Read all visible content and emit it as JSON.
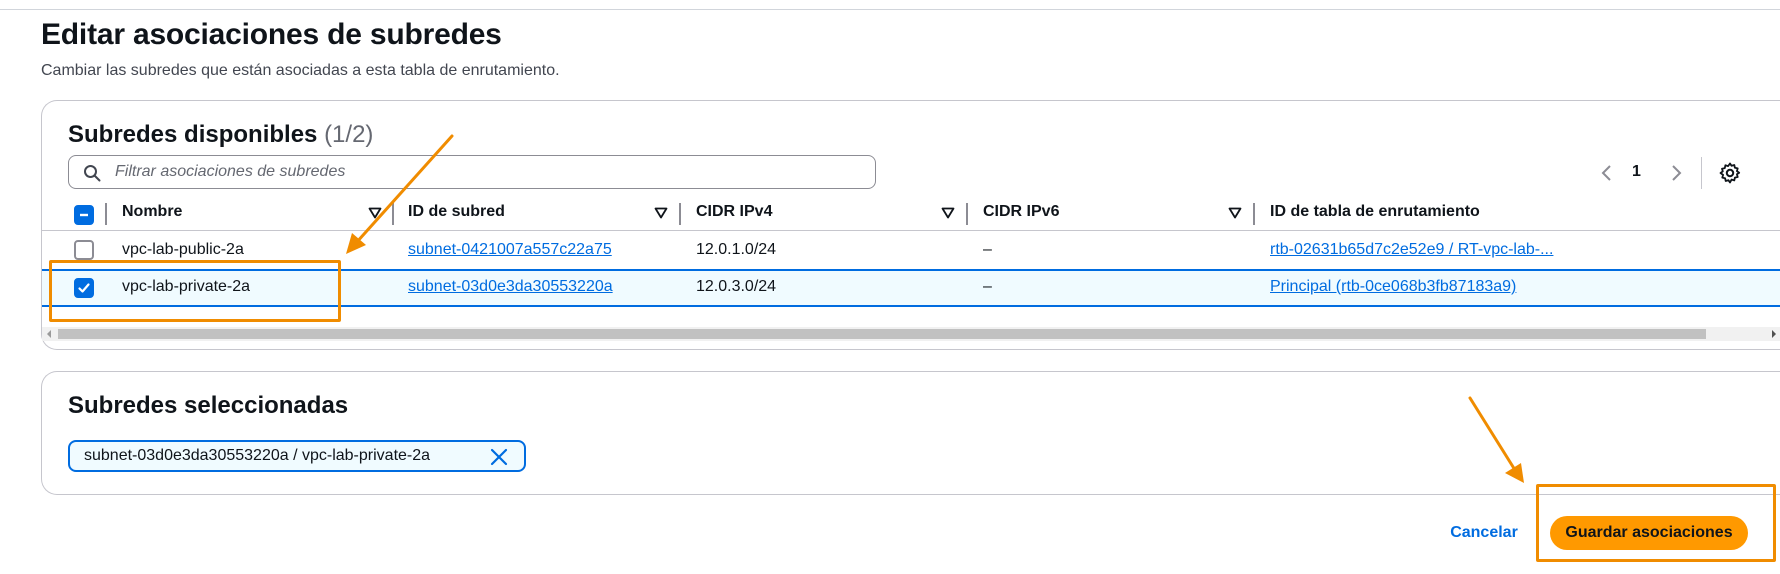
{
  "page": {
    "title": "Editar asociaciones de subredes",
    "description": "Cambiar las subredes que están asociadas a esta tabla de enrutamiento."
  },
  "available": {
    "title": "Subredes disponibles",
    "count": "(1/2)",
    "search_placeholder": "Filtrar asociaciones de subredes",
    "page_number": "1",
    "columns": [
      "Nombre",
      "ID de subred",
      "CIDR IPv4",
      "CIDR IPv6",
      "ID de tabla de enrutamiento"
    ],
    "rows": [
      {
        "selected": false,
        "name": "vpc-lab-public-2a",
        "subnet_id": "subnet-0421007a557c22a75",
        "cidr_ipv4": "12.0.1.0/24",
        "cidr_ipv6": "–",
        "route_table": "rtb-02631b65d7c2e52e9 / RT-vpc-lab-..."
      },
      {
        "selected": true,
        "name": "vpc-lab-private-2a",
        "subnet_id": "subnet-03d0e3da30553220a",
        "cidr_ipv4": "12.0.3.0/24",
        "cidr_ipv6": "–",
        "route_table": "Principal (rtb-0ce068b3fb87183a9)"
      }
    ]
  },
  "selected": {
    "title": "Subredes seleccionadas",
    "token": "subnet-03d0e3da30553220a / vpc-lab-private-2a"
  },
  "actions": {
    "cancel": "Cancelar",
    "save": "Guardar asociaciones"
  },
  "colors": {
    "primary_blue": "#006ce0",
    "save_button": "#ff9900",
    "annotation_orange": "#f08c00"
  },
  "icons": [
    "search-icon",
    "chevron-left-icon",
    "chevron-right-icon",
    "gear-icon",
    "sort-down-icon",
    "checkbox-check-icon",
    "checkbox-indeterminate-icon",
    "close-icon"
  ]
}
